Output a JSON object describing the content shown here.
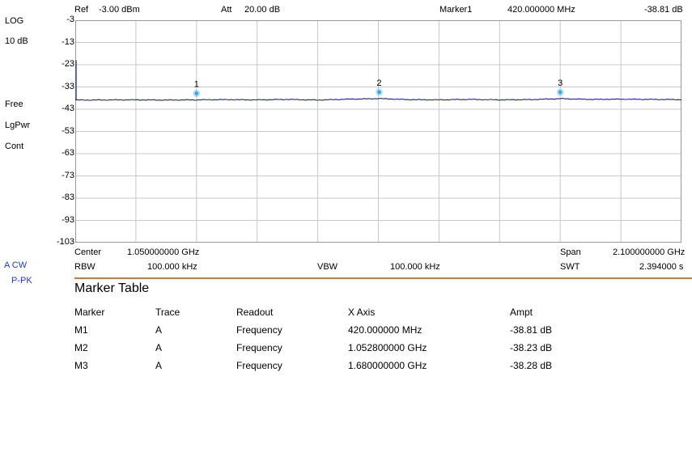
{
  "header": {
    "ref_label": "Ref",
    "ref_value": "-3.00 dBm",
    "att_label": "Att",
    "att_value": "20.00 dB",
    "marker_label": "Marker1",
    "marker_freq": "420.000000 MHz",
    "marker_ampt": "-38.81 dB"
  },
  "sidebar": {
    "scale_type": "LOG",
    "scale_div": "10 dB",
    "trigger": "Free",
    "detector": "LgPwr",
    "sweep_mode": "Cont",
    "trace_mode": "A CW",
    "trace_detector": "P-PK"
  },
  "y_axis": {
    "ticks": [
      "-3",
      "-13",
      "-23",
      "-33",
      "-43",
      "-53",
      "-63",
      "-73",
      "-83",
      "-93",
      "-103"
    ]
  },
  "chart_data": {
    "type": "line",
    "ylim": [
      -103,
      -3
    ],
    "xlim": [
      0,
      2.1
    ],
    "x_unit": "GHz",
    "y_unit": "dB",
    "grid": true,
    "series": [
      {
        "color": "#1a237e",
        "x": [
          0,
          0.105,
          0.21,
          0.315,
          0.42,
          0.525,
          0.63,
          0.735,
          0.84,
          0.945,
          1.0528,
          1.155,
          1.26,
          1.365,
          1.47,
          1.575,
          1.68,
          1.785,
          1.89,
          1.995,
          2.1
        ],
        "y": [
          -38.9,
          -38.85,
          -38.8,
          -38.9,
          -38.81,
          -38.7,
          -38.8,
          -38.6,
          -38.9,
          -38.5,
          -38.23,
          -38.7,
          -38.8,
          -38.6,
          -38.8,
          -38.7,
          -38.28,
          -38.6,
          -38.5,
          -38.6,
          -38.7
        ]
      }
    ],
    "markers": [
      {
        "label": "1",
        "x": 0.42,
        "y": -38.81
      },
      {
        "label": "2",
        "x": 1.0528,
        "y": -38.23
      },
      {
        "label": "3",
        "x": 1.68,
        "y": -38.28
      }
    ]
  },
  "footer": {
    "center_label": "Center",
    "center_value": "1.050000000 GHz",
    "span_label": "Span",
    "span_value": "2.100000000 GHz",
    "rbw_label": "RBW",
    "rbw_value": "100.000 kHz",
    "vbw_label": "VBW",
    "vbw_value": "100.000 kHz",
    "swt_label": "SWT",
    "swt_value": "2.394000 s"
  },
  "marker_table": {
    "title": "Marker Table",
    "headers": [
      "Marker",
      "Trace",
      "Readout",
      "X Axis",
      "Ampt"
    ],
    "rows": [
      [
        "M1",
        "A",
        "Frequency",
        "420.000000 MHz",
        "-38.81 dB"
      ],
      [
        "M2",
        "A",
        "Frequency",
        "1.052800000 GHz",
        "-38.23 dB"
      ],
      [
        "M3",
        "A",
        "Frequency",
        "1.680000000 GHz",
        "-38.28 dB"
      ]
    ]
  },
  "colors": {
    "trace": "#1a237e",
    "grid": "#c8c8c8",
    "marker": "#35a6e6",
    "separator": "#cd7a3a",
    "side_blue": "#1f3fbf"
  }
}
